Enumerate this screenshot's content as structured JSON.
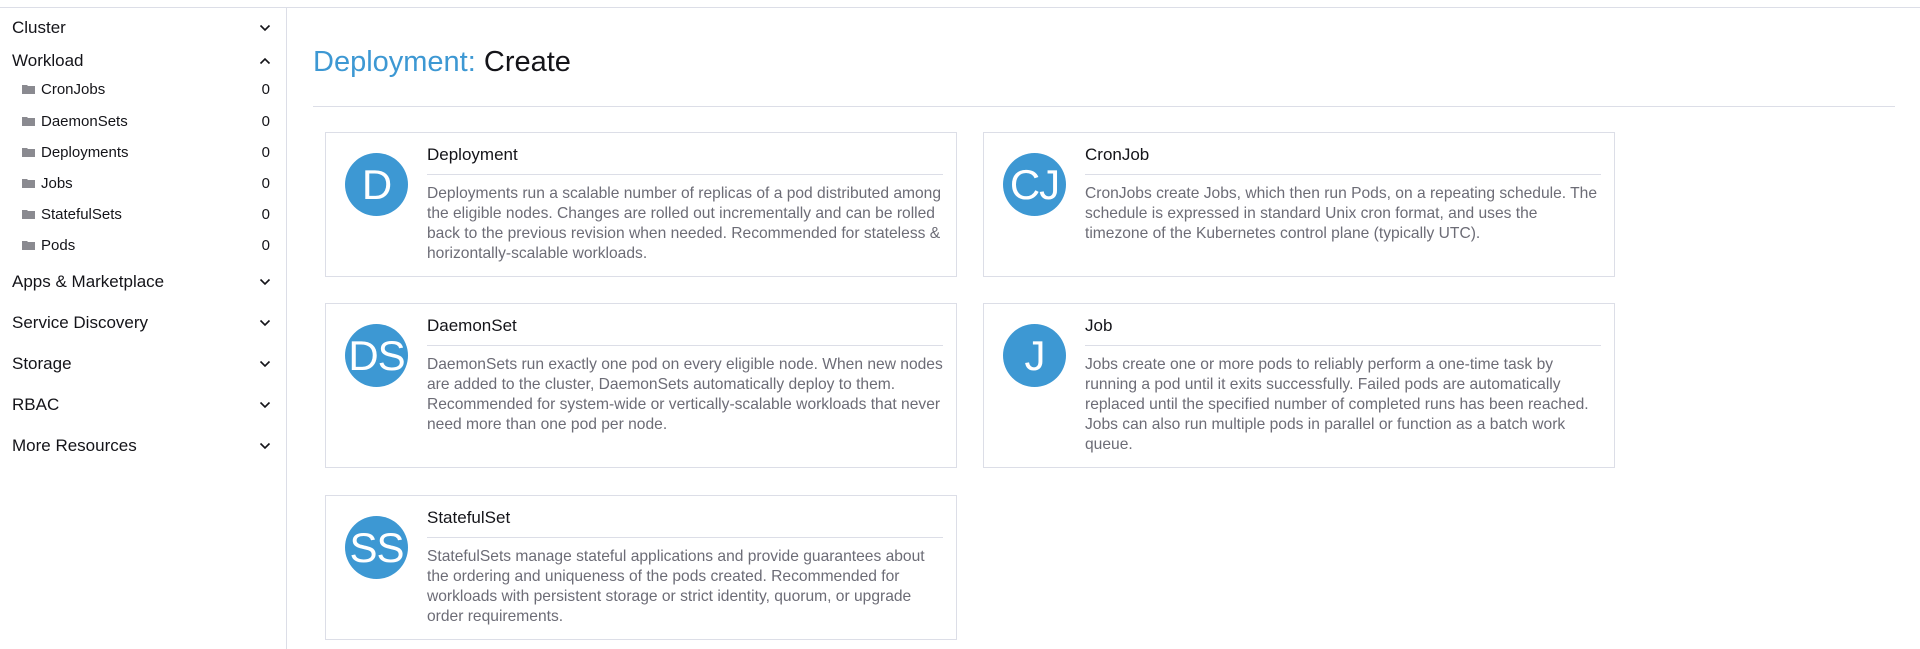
{
  "sidebar": {
    "groups": [
      {
        "label": "Cluster",
        "state": "collapsed"
      },
      {
        "label": "Workload",
        "state": "expanded"
      },
      {
        "label": "Apps & Marketplace",
        "state": "collapsed"
      },
      {
        "label": "Service Discovery",
        "state": "collapsed"
      },
      {
        "label": "Storage",
        "state": "collapsed"
      },
      {
        "label": "RBAC",
        "state": "collapsed"
      },
      {
        "label": "More Resources",
        "state": "collapsed"
      }
    ],
    "workload_items": [
      {
        "label": "CronJobs",
        "count": "0"
      },
      {
        "label": "DaemonSets",
        "count": "0"
      },
      {
        "label": "Deployments",
        "count": "0"
      },
      {
        "label": "Jobs",
        "count": "0"
      },
      {
        "label": "StatefulSets",
        "count": "0"
      },
      {
        "label": "Pods",
        "count": "0"
      }
    ]
  },
  "header": {
    "resource": "Deployment:",
    "action": "Create"
  },
  "cards": [
    {
      "initials": "D",
      "title": "Deployment",
      "description": "Deployments run a scalable number of replicas of a pod distributed among the eligible nodes. Changes are rolled out incrementally and can be rolled back to the previous revision when needed. Recommended for stateless & horizontally-scalable workloads."
    },
    {
      "initials": "CJ",
      "title": "CronJob",
      "description": "CronJobs create Jobs, which then run Pods, on a repeating schedule. The schedule is expressed in standard Unix cron format, and uses the timezone of the Kubernetes control plane (typically UTC)."
    },
    {
      "initials": "DS",
      "title": "DaemonSet",
      "description": "DaemonSets run exactly one pod on every eligible node. When new nodes are added to the cluster, DaemonSets automatically deploy to them. Recommended for system-wide or vertically-scalable workloads that never need more than one pod per node."
    },
    {
      "initials": "J",
      "title": "Job",
      "description": "Jobs create one or more pods to reliably perform a one-time task by running a pod until it exits successfully. Failed pods are automatically replaced until the specified number of completed runs has been reached. Jobs can also run multiple pods in parallel or function as a batch work queue."
    },
    {
      "initials": "SS",
      "title": "StatefulSet",
      "description": "StatefulSets manage stateful applications and provide guarantees about the ordering and uniqueness of the pods created. Recommended for workloads with persistent storage or strict identity, quorum, or upgrade order requirements."
    }
  ],
  "colors": {
    "accent": "#3d98d3",
    "text": "#141419",
    "muted": "#6c6c76",
    "border": "#dcdee7"
  }
}
